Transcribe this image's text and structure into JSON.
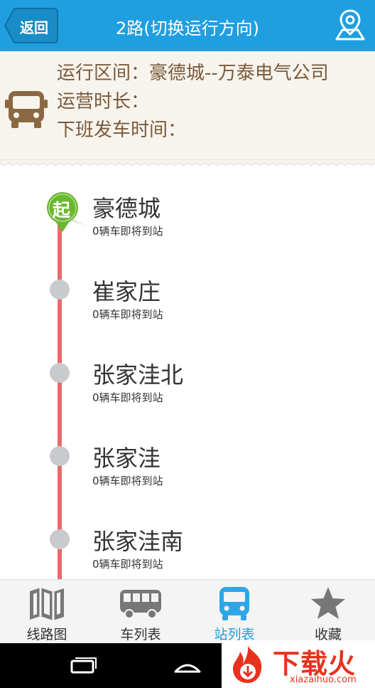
{
  "header": {
    "back_label": "返回",
    "title": "2路(切换运行方向)",
    "map_icon": "map-pin-icon",
    "color": "#1f9fe0"
  },
  "route_info": {
    "section_label": "运行区间：",
    "section_value": "豪德城--万泰电气公司",
    "duration_label": "运营时长：",
    "duration_value": "",
    "schedule_label": "下班发车时间：",
    "schedule_value": "",
    "icon": "bus-front-icon"
  },
  "stops": [
    {
      "name": "豪德城",
      "status": "0辆车即将到站",
      "start_badge": "起"
    },
    {
      "name": "崔家庄",
      "status": "0辆车即将到站"
    },
    {
      "name": "张家洼北",
      "status": "0辆车即将到站"
    },
    {
      "name": "张家洼",
      "status": "0辆车即将到站"
    },
    {
      "name": "张家洼南",
      "status": "0辆车即将到站"
    }
  ],
  "tabs": [
    {
      "label": "线路图",
      "icon": "map-icon",
      "active": false
    },
    {
      "label": "车列表",
      "icon": "bus-icon",
      "active": false
    },
    {
      "label": "站列表",
      "icon": "bus-stop-icon",
      "active": true
    },
    {
      "label": "收藏",
      "icon": "star-icon",
      "active": false
    }
  ],
  "watermark": {
    "main": "下载火",
    "sub": "xiazaihuo.com"
  },
  "colors": {
    "accent": "#1f9fe0",
    "route_line": "#e86a6a",
    "start_badge": "#6ab82e",
    "info_text": "#7a5a3a"
  }
}
